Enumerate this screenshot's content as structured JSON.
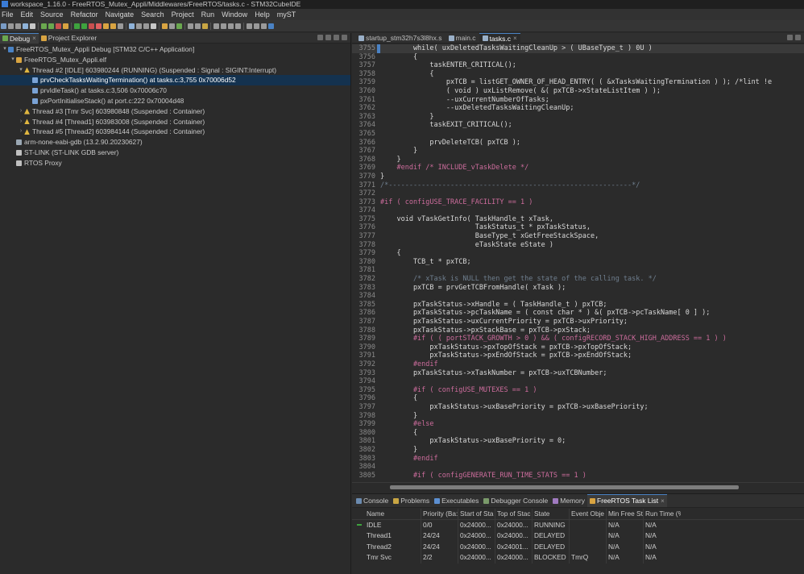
{
  "window": {
    "title": "workspace_1.16.0 - FreeRTOS_Mutex_Appli/Middlewares/FreeRTOS/tasks.c - STM32CubeIDE"
  },
  "menu": [
    "File",
    "Edit",
    "Source",
    "Refactor",
    "Navigate",
    "Search",
    "Project",
    "Run",
    "Window",
    "Help",
    "myST"
  ],
  "left_panel": {
    "tabs": [
      {
        "label": "Debug",
        "active": true,
        "closable": true
      },
      {
        "label": "Project Explorer",
        "active": false,
        "closable": false
      }
    ],
    "tree": [
      {
        "indent": 0,
        "twisty": "v",
        "icon": "launch",
        "label": "FreeRTOS_Mutex_Appli Debug [STM32 C/C++ Application]"
      },
      {
        "indent": 1,
        "twisty": "v",
        "icon": "elf",
        "label": "FreeRTOS_Mutex_Appli.elf"
      },
      {
        "indent": 2,
        "twisty": "v",
        "icon": "thread",
        "label": "Thread #2 [IDLE] 603980244 (RUNNING) (Suspended : Signal : SIGINT:Interrupt)"
      },
      {
        "indent": 3,
        "twisty": "",
        "icon": "frame",
        "label": "prvCheckTasksWaitingTermination() at tasks.c:3,755 0x70006d52",
        "selected": true
      },
      {
        "indent": 3,
        "twisty": "",
        "icon": "frame",
        "label": "prvIdleTask() at tasks.c:3,506 0x70006c70"
      },
      {
        "indent": 3,
        "twisty": "",
        "icon": "frame",
        "label": "pxPortInitialiseStack() at port.c:222 0x70004d48"
      },
      {
        "indent": 2,
        "twisty": ">",
        "icon": "thread",
        "label": "Thread #3 [Tmr Svc] 603980848 (Suspended : Container)"
      },
      {
        "indent": 2,
        "twisty": ">",
        "icon": "thread",
        "label": "Thread #4 [Thread1] 603983008 (Suspended : Container)"
      },
      {
        "indent": 2,
        "twisty": ">",
        "icon": "thread",
        "label": "Thread #5 [Thread2] 603984144 (Suspended : Container)"
      },
      {
        "indent": 1,
        "twisty": "",
        "icon": "gdb",
        "label": "arm-none-eabi-gdb (13.2.90.20230627)"
      },
      {
        "indent": 1,
        "twisty": "",
        "icon": "link",
        "label": "ST-LINK (ST-LINK GDB server)"
      },
      {
        "indent": 1,
        "twisty": "",
        "icon": "link",
        "label": "RTOS Proxy"
      }
    ]
  },
  "editor": {
    "tabs": [
      {
        "label": "startup_stm32h7s3l8hx.s",
        "active": false,
        "closable": false
      },
      {
        "label": "main.c",
        "active": false,
        "closable": false
      },
      {
        "label": "tasks.c",
        "active": true,
        "closable": true
      }
    ],
    "lines": [
      {
        "n": "3755",
        "text": "        while( uxDeletedTasksWaitingCleanUp > ( UBaseType_t ) 0U )",
        "hl": true
      },
      {
        "n": "3756",
        "text": "        {"
      },
      {
        "n": "3757",
        "text": "            taskENTER_CRITICAL();"
      },
      {
        "n": "3758",
        "text": "            {"
      },
      {
        "n": "3759",
        "text": "                pxTCB = listGET_OWNER_OF_HEAD_ENTRY( ( &xTasksWaitingTermination ) ); /*lint !e"
      },
      {
        "n": "3760",
        "text": "                ( void ) uxListRemove( &( pxTCB->xStateListItem ) );"
      },
      {
        "n": "3761",
        "text": "                --uxCurrentNumberOfTasks;"
      },
      {
        "n": "3762",
        "text": "                --uxDeletedTasksWaitingCleanUp;"
      },
      {
        "n": "3763",
        "text": "            }"
      },
      {
        "n": "3764",
        "text": "            taskEXIT_CRITICAL();"
      },
      {
        "n": "3765",
        "text": ""
      },
      {
        "n": "3766",
        "text": "            prvDeleteTCB( pxTCB );"
      },
      {
        "n": "3767",
        "text": "        }"
      },
      {
        "n": "3768",
        "text": "    }"
      },
      {
        "n": "3769",
        "text": "    #endif /* INCLUDE_vTaskDelete */"
      },
      {
        "n": "3770",
        "text": "}"
      },
      {
        "n": "3771",
        "text": "/*-----------------------------------------------------------*/"
      },
      {
        "n": "3772",
        "text": ""
      },
      {
        "n": "3773",
        "text": "#if ( configUSE_TRACE_FACILITY == 1 )"
      },
      {
        "n": "3774",
        "text": ""
      },
      {
        "n": "3775",
        "text": "    void vTaskGetInfo( TaskHandle_t xTask,"
      },
      {
        "n": "3776",
        "text": "                       TaskStatus_t * pxTaskStatus,"
      },
      {
        "n": "3777",
        "text": "                       BaseType_t xGetFreeStackSpace,"
      },
      {
        "n": "3778",
        "text": "                       eTaskState eState )"
      },
      {
        "n": "3779",
        "text": "    {"
      },
      {
        "n": "3780",
        "text": "        TCB_t * pxTCB;"
      },
      {
        "n": "3781",
        "text": ""
      },
      {
        "n": "3782",
        "text": "        /* xTask is NULL then get the state of the calling task. */"
      },
      {
        "n": "3783",
        "text": "        pxTCB = prvGetTCBFromHandle( xTask );"
      },
      {
        "n": "3784",
        "text": ""
      },
      {
        "n": "3785",
        "text": "        pxTaskStatus->xHandle = ( TaskHandle_t ) pxTCB;"
      },
      {
        "n": "3786",
        "text": "        pxTaskStatus->pcTaskName = ( const char * ) &( pxTCB->pcTaskName[ 0 ] );"
      },
      {
        "n": "3787",
        "text": "        pxTaskStatus->uxCurrentPriority = pxTCB->uxPriority;"
      },
      {
        "n": "3788",
        "text": "        pxTaskStatus->pxStackBase = pxTCB->pxStack;"
      },
      {
        "n": "3789",
        "text": "        #if ( ( portSTACK_GROWTH > 0 ) && ( configRECORD_STACK_HIGH_ADDRESS == 1 ) )"
      },
      {
        "n": "3790",
        "text": "            pxTaskStatus->pxTopOfStack = pxTCB->pxTopOfStack;"
      },
      {
        "n": "3791",
        "text": "            pxTaskStatus->pxEndOfStack = pxTCB->pxEndOfStack;"
      },
      {
        "n": "3792",
        "text": "        #endif"
      },
      {
        "n": "3793",
        "text": "        pxTaskStatus->xTaskNumber = pxTCB->uxTCBNumber;"
      },
      {
        "n": "3794",
        "text": ""
      },
      {
        "n": "3795",
        "text": "        #if ( configUSE_MUTEXES == 1 )"
      },
      {
        "n": "3796",
        "text": "        {"
      },
      {
        "n": "3797",
        "text": "            pxTaskStatus->uxBasePriority = pxTCB->uxBasePriority;"
      },
      {
        "n": "3798",
        "text": "        }"
      },
      {
        "n": "3799",
        "text": "        #else"
      },
      {
        "n": "3800",
        "text": "        {"
      },
      {
        "n": "3801",
        "text": "            pxTaskStatus->uxBasePriority = 0;"
      },
      {
        "n": "3802",
        "text": "        }"
      },
      {
        "n": "3803",
        "text": "        #endif"
      },
      {
        "n": "3804",
        "text": ""
      },
      {
        "n": "3805",
        "text": "        #if ( configGENERATE_RUN_TIME_STATS == 1 )"
      }
    ]
  },
  "bottom_panel": {
    "tabs": [
      {
        "label": "Console",
        "icon": "console",
        "active": false,
        "closable": false
      },
      {
        "label": "Problems",
        "icon": "problems",
        "active": false,
        "closable": false
      },
      {
        "label": "Executables",
        "icon": "exec",
        "active": false,
        "closable": false
      },
      {
        "label": "Debugger Console",
        "icon": "dbgcon",
        "active": false,
        "closable": false
      },
      {
        "label": "Memory",
        "icon": "memory",
        "active": false,
        "closable": false
      },
      {
        "label": "FreeRTOS Task List",
        "icon": "rtos",
        "active": true,
        "closable": true
      }
    ],
    "columns": [
      "Name",
      "Priority (Ba:",
      "Start of Sta",
      "Top of Stac",
      "State",
      "Event Obje",
      "Min Free St",
      "Run Time (%"
    ],
    "rows": [
      {
        "running": true,
        "cells": [
          "IDLE",
          "0/0",
          "0x24000...",
          "0x24000...",
          "RUNNING",
          "",
          "N/A",
          "N/A"
        ]
      },
      {
        "running": false,
        "cells": [
          "Thread1",
          "24/24",
          "0x24000...",
          "0x24000...",
          "DELAYED",
          "",
          "N/A",
          "N/A"
        ]
      },
      {
        "running": false,
        "cells": [
          "Thread2",
          "24/24",
          "0x24000...",
          "0x24001...",
          "DELAYED",
          "",
          "N/A",
          "N/A"
        ]
      },
      {
        "running": false,
        "cells": [
          "Tmr Svc",
          "2/2",
          "0x24000...",
          "0x24000...",
          "BLOCKED",
          "TmrQ",
          "N/A",
          "N/A"
        ]
      }
    ]
  },
  "scrollbar": {
    "horizontal_position": 0.08
  }
}
